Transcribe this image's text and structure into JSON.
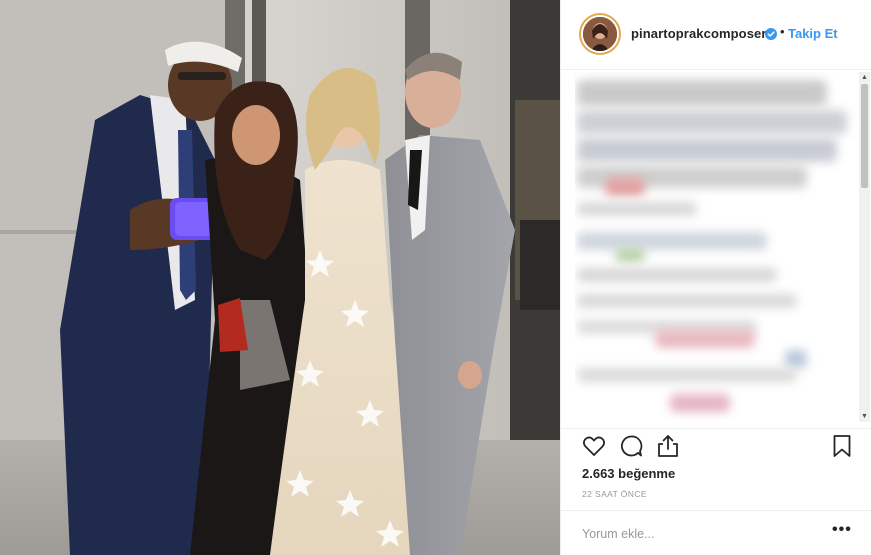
{
  "post": {
    "username": "pinartoprakcomposer",
    "separator": "•",
    "follow_label": "Takip Et",
    "likes_text": "2.663 beğenme",
    "time_text": "22 SAAT ÖNCE",
    "comment_placeholder": "Yorum ekle...",
    "more_options": "•••"
  },
  "icons": {
    "like": "heart-icon",
    "comment": "speech-bubble-icon",
    "share": "share-icon",
    "save": "bookmark-icon",
    "verified": "verified-badge-icon"
  },
  "colors": {
    "accent": "#3897f0",
    "text": "#262626",
    "muted": "#999999",
    "border": "#efefef"
  }
}
